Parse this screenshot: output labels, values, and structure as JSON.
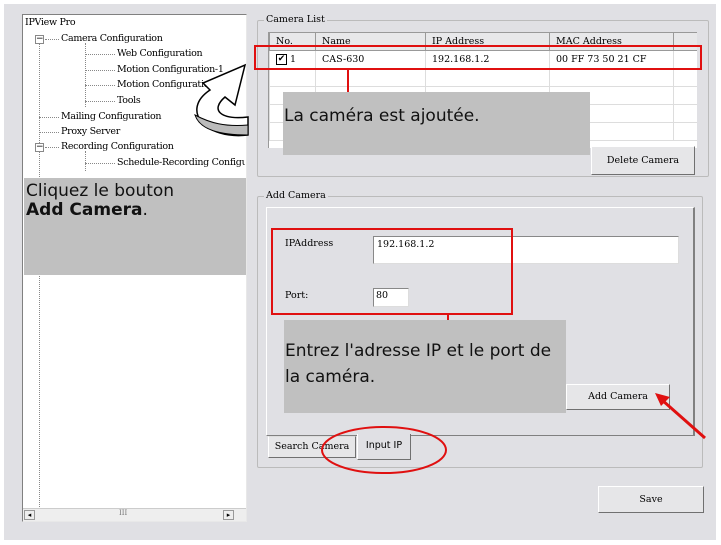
{
  "tree": {
    "root": "IPView Pro",
    "items": [
      "Camera Configuration",
      "Web Configuration",
      "Motion Configuration-1",
      "Motion Configuration",
      "Tools",
      "Mailing Configuration",
      "Proxy Server",
      "Recording Configuration",
      "Schedule-Recording Configu"
    ],
    "scroll_marker": "III"
  },
  "camera_list": {
    "title": "Camera List",
    "columns": [
      "No.",
      "Name",
      "IP Address",
      "MAC Address"
    ],
    "rows": [
      {
        "no": "1",
        "checked": true,
        "name": "CAS-630",
        "ip": "192.168.1.2",
        "mac": "00 FF 73 50 21 CF"
      }
    ],
    "delete_button": "Delete Camera"
  },
  "add_camera": {
    "title": "Add Camera",
    "ip_label": "IPAddress",
    "ip_value": "192.168.1.2",
    "port_label": "Port:",
    "port_value": "80",
    "add_button": "Add Camera",
    "tabs": [
      "Search Camera",
      "Input IP"
    ],
    "active_tab": "Input IP"
  },
  "save_button": "Save",
  "callouts": {
    "click_prefix": "Cliquez le bouton ",
    "click_bold": "Add Camera",
    "click_suffix": ".",
    "added": "La caméra est ajoutée.",
    "enter": "Entrez l'adresse IP et le port de la caméra."
  },
  "colors": {
    "highlight": "#e01010",
    "callout": "#c0c0c0"
  }
}
